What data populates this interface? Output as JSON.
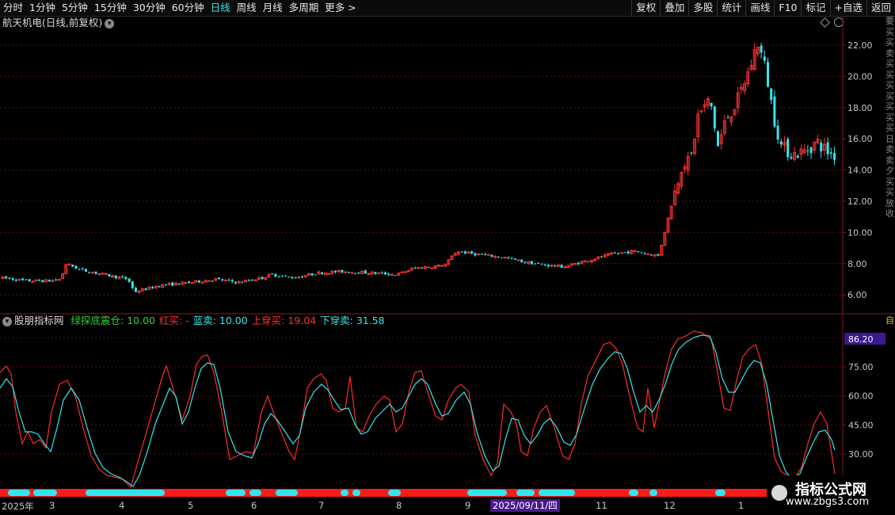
{
  "toolbar": {
    "periods": [
      "分时",
      "1分钟",
      "5分钟",
      "15分钟",
      "30分钟",
      "60分钟",
      "日线",
      "周线",
      "月线",
      "多周期",
      "更多 >"
    ],
    "active": "日线",
    "right_buttons": [
      "复权",
      "叠加",
      "多股",
      "统计",
      "画线",
      "F10",
      "标记",
      "+自选",
      "返回"
    ]
  },
  "price_chart": {
    "title": "航天机电(日线,前复权)",
    "y_ticks": [
      "22.00",
      "20.00",
      "18.00",
      "16.00",
      "14.00",
      "12.00",
      "10.00",
      "8.00",
      "6.00"
    ],
    "colors": {
      "up": "#ff3333",
      "down": "#33e6ee",
      "grid": "#5a1010"
    }
  },
  "indicator": {
    "name": "股朋指标网",
    "items": [
      {
        "label": "绿探底震仓: 10.00",
        "color": "#33cc33"
      },
      {
        "label": "红买: -",
        "color": "#ff3333"
      },
      {
        "label": "蓝卖: 10.00",
        "color": "#33e6ee"
      },
      {
        "label": "上穿买: 19.04",
        "color": "#ff3333"
      },
      {
        "label": "下穿卖: 31.58",
        "color": "#33e6ee"
      }
    ],
    "y_ticks": [
      "75.00",
      "60.00",
      "45.00",
      "30.00"
    ],
    "current_value": "86.20"
  },
  "date_axis": {
    "labels": [
      "2025年",
      "3",
      "4",
      "5",
      "6",
      "7",
      "8",
      "9",
      "11",
      "12",
      "1"
    ],
    "highlight": "2025/09/11/四"
  },
  "watermark": {
    "line1": "指标公式网",
    "line2": "www.zbgs3.com"
  },
  "right_strip": {
    "text": "要买买卖买买买买买买买日卖卖夕买买放收",
    "tag": "自"
  }
}
